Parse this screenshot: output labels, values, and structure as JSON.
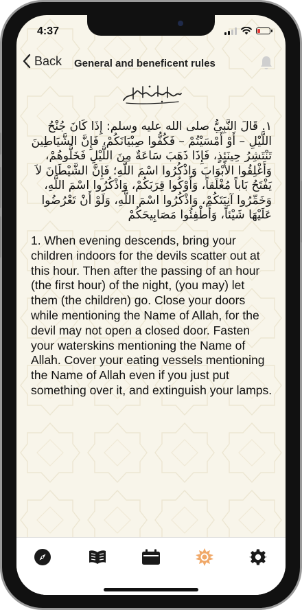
{
  "status_bar": {
    "time": "4:37",
    "battery_level": 0.2,
    "battery_color": "#e53935"
  },
  "nav": {
    "back_label": "Back",
    "title": "General and beneficent rules",
    "bell_icon": "bell-icon"
  },
  "content": {
    "bismillah_calligraphy": "بسم الله الرحمن الرحيم",
    "arabic_text": "١. قَالَ النَّبِيُّ صلى الله عليه وسلم: إِذَا كَانَ جُنْحُ اللَّيْلِ – أَوْ أَمْسَيْتُمْ – فَكُفُّوا صِبْيَانَكُمْ، فَإِنَّ الشَّيَاطِينَ تَنْتَشِرُ حِينَئِذٍ، فَإِذَا ذَهَبَ سَاعَةٌ مِنَ اللَّيْلِ فَخَلُّوهُمْ، وَأَغْلِقُوا الأَبْوَابَ وَاذْكُرُوا اسْمَ اللَّهِ؛ فَإِنَّ الشَّيْطَانَ لاَ يَفْتَحُ بَاباً مُغْلَقاً، وَأَوْكُوا قِرَبَكُمْ، وَاذْكُرُوا اسْمَ اللَّهِ، وَخَمِّرُوا آنِيَتَكُمْ، وَاذْكُرُوا اسْمَ اللَّهِ، وَلَوْ أَنْ تَعْرُضُوا عَلَيْهَا شَيْئاً، وَأَطْفِئُوا مَصَابِيحَكُمْ",
    "english_text": "1. When evening descends, bring your children indoors for the devils scatter out at this hour. Then after the passing of an hour (the first hour) of the night, (you may) let them (the children) go. Close your doors while mentioning the Name of Allah, for the devil may not open a closed door. Fasten your waterskins mentioning the Name of Allah. Cover your eating vessels mentioning the Name of Allah even if you just put something over it, and extinguish your lamps."
  },
  "tab_bar": {
    "tabs": [
      {
        "icon": "compass-icon",
        "active": false
      },
      {
        "icon": "book-icon",
        "active": false
      },
      {
        "icon": "calendar-icon",
        "active": false
      },
      {
        "icon": "sun-star-icon",
        "active": true
      },
      {
        "icon": "settings-gear-icon",
        "active": false
      }
    ],
    "active_color": "#f0a868",
    "inactive_color": "#1a1a1a"
  }
}
